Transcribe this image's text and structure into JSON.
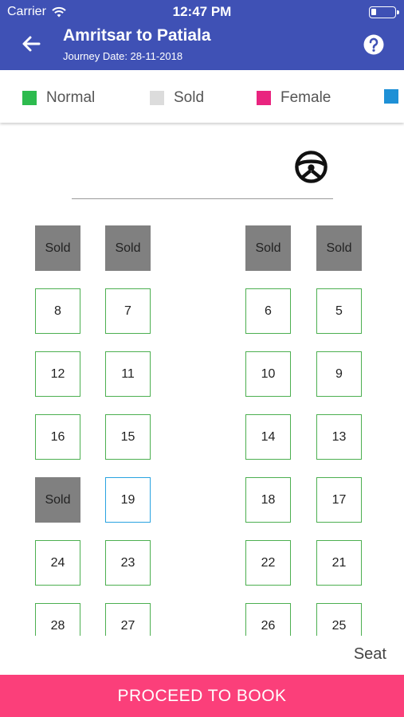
{
  "status_bar": {
    "carrier": "Carrier",
    "time": "12:47 PM"
  },
  "header": {
    "title": "Amritsar to Patiala",
    "subtitle": "Journey Date: 28-11-2018",
    "back_icon": "arrow-left-icon",
    "help_icon": "help-circle-icon",
    "background": "#3f51b5"
  },
  "legend": [
    {
      "label": "Normal",
      "color": "#2dbb4e"
    },
    {
      "label": "Sold",
      "color": "#dcdcdc"
    },
    {
      "label": "Female",
      "color": "#e9247f"
    },
    {
      "label": "",
      "color": "#1e90d6"
    }
  ],
  "seats": {
    "rows": [
      [
        "Sold",
        "Sold",
        "Sold",
        "Sold"
      ],
      [
        "8",
        "7",
        "6",
        "5"
      ],
      [
        "12",
        "11",
        "10",
        "9"
      ],
      [
        "16",
        "15",
        "14",
        "13"
      ],
      [
        "Sold",
        "19",
        "18",
        "17"
      ],
      [
        "24",
        "23",
        "22",
        "21"
      ],
      [
        "28",
        "27",
        "26",
        "25"
      ]
    ],
    "status": [
      [
        "sold",
        "sold",
        "sold",
        "sold"
      ],
      [
        "normal",
        "normal",
        "normal",
        "normal"
      ],
      [
        "normal",
        "normal",
        "normal",
        "normal"
      ],
      [
        "normal",
        "normal",
        "normal",
        "normal"
      ],
      [
        "sold",
        "selected",
        "normal",
        "normal"
      ],
      [
        "normal",
        "normal",
        "normal",
        "normal"
      ],
      [
        "normal",
        "normal",
        "normal",
        "normal"
      ]
    ]
  },
  "seat_label": "Seat",
  "proceed_label": "PROCEED TO BOOK",
  "colors": {
    "proceed": "#fb3f7a",
    "normal_border": "#4caf50",
    "sold_fill": "#808080",
    "selected_border": "#29a3e0"
  }
}
